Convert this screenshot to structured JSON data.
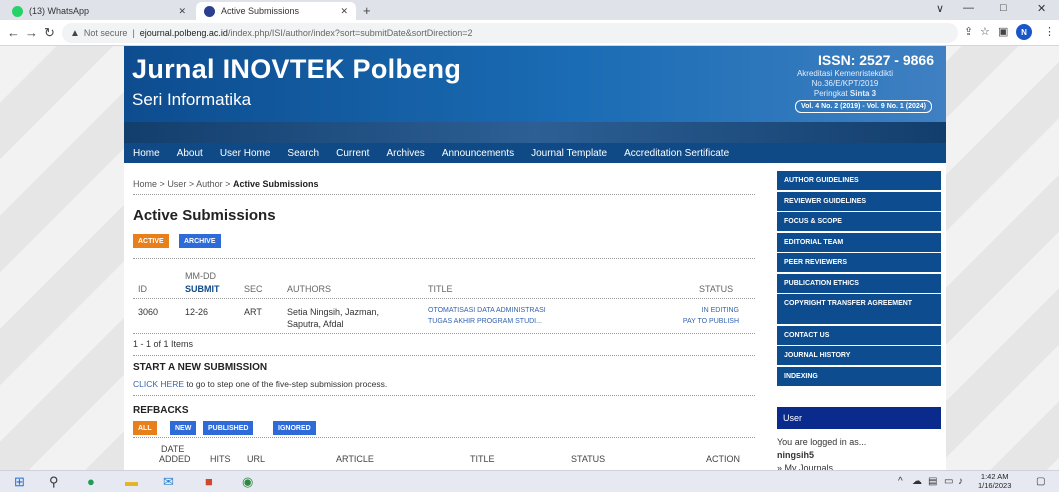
{
  "browser": {
    "tabs": [
      {
        "label": "(13) WhatsApp"
      },
      {
        "label": "Active Submissions"
      }
    ],
    "new_tab": "+",
    "window_controls": [
      "∨",
      "—",
      "□",
      "✕"
    ],
    "url_prefix": "Not secure",
    "url_separator": "|",
    "url_host": "ejournal.polbeng.ac.id",
    "url_path": "/index.php/ISI/author/index?sort=submitDate&sortDirection=2",
    "profile_initial": "N"
  },
  "banner": {
    "title": "Jurnal INOVTEK Polbeng",
    "subtitle": "Seri Informatika",
    "issn": "ISSN: 2527 - 9866",
    "accreditation_line1": "Akreditasi Kemenristekdikti",
    "accreditation_line2": "No.36/E/KPT/2019",
    "accreditation_line3_prefix": "Peringkat",
    "accreditation_line3_bold": "Sinta 3",
    "volumes": "Vol. 4 No. 2 (2019) - Vol. 9 No. 1 (2024)"
  },
  "menu": [
    "Home",
    "About",
    "User Home",
    "Search",
    "Current",
    "Archives",
    "Announcements",
    "Journal Template",
    "Accreditation Sertificate"
  ],
  "breadcrumb": {
    "home": "Home",
    "sep": ">",
    "user": "User",
    "author": "Author",
    "current": "Active Submissions"
  },
  "page_title": "Active Submissions",
  "tabs": {
    "active": "ACTIVE",
    "archive": "ARCHIVE"
  },
  "table": {
    "headers": {
      "id": "ID",
      "mmdd": "MM-DD",
      "submit": "SUBMIT",
      "sec": "SEC",
      "authors": "AUTHORS",
      "title": "TITLE",
      "status": "STATUS"
    },
    "rows": [
      {
        "id": "3060",
        "date": "12-26",
        "sec": "ART",
        "authors_line1": "Setia Ningsih, Jazman,",
        "authors_line2": "Saputra, Afdal",
        "title_line1": "OTOMATISASI DATA ADMINISTRASI",
        "title_line2": "TUGAS AKHIR PROGRAM STUDI...",
        "status_line1": "IN EDITING",
        "status_line2": "PAY TO PUBLISH"
      }
    ],
    "count": "1 - 1 of 1 Items"
  },
  "new_submission": {
    "heading": "START A NEW SUBMISSION",
    "link": "CLICK HERE",
    "text": " to go to step one of the five-step submission process."
  },
  "refbacks": {
    "heading": "REFBACKS",
    "tabs": [
      "ALL",
      "NEW",
      "PUBLISHED",
      "IGNORED"
    ],
    "headers": {
      "date": "DATE",
      "added": "ADDED",
      "hits": "HITS",
      "url": "URL",
      "article": "ARTICLE",
      "title": "TITLE",
      "status": "STATUS",
      "action": "ACTION"
    }
  },
  "sidebar": {
    "items": [
      "AUTHOR GUIDELINES",
      "REVIEWER GUIDELINES",
      "FOCUS & SCOPE",
      "EDITORIAL TEAM",
      "PEER REVIEWERS",
      "PUBLICATION ETHICS",
      "COPYRIGHT TRANSFER AGREEMENT",
      "CONTACT US",
      "JOURNAL HISTORY",
      "INDEXING"
    ],
    "user_block": "User",
    "logged_in": "You are logged in as...",
    "username": "ningsih5",
    "my_journals": "» My Journals"
  },
  "taskbar": {
    "time": "1:42 AM",
    "date": "1/16/2023"
  },
  "colors": {
    "banner": "#0d4c8f",
    "menu": "#0f4a87",
    "orange": "#e87f1a",
    "blue_tab": "#2f6bd8",
    "user_block": "#0a2a8c"
  }
}
